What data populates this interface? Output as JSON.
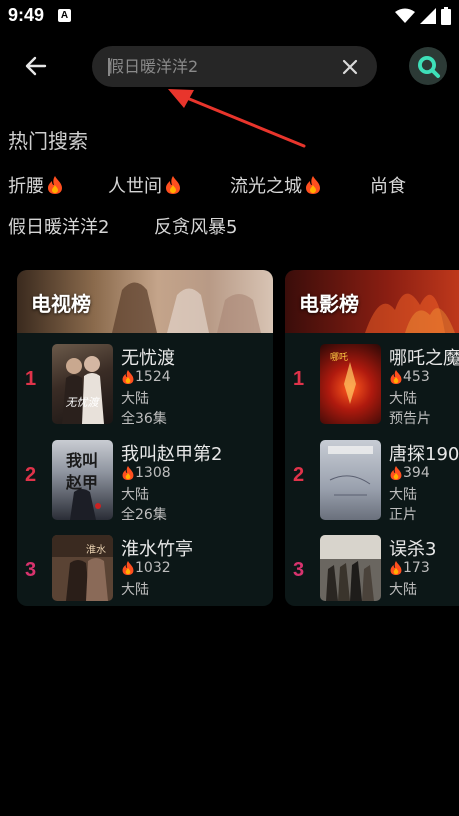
{
  "status": {
    "time": "9:49",
    "notif": "A"
  },
  "search": {
    "value": "",
    "placeholder": "假日暖洋洋2"
  },
  "hot_search": {
    "title": "热门搜索",
    "row1": [
      "折腰",
      "人世间",
      "流光之城",
      "尚食"
    ],
    "row1_hot": [
      true,
      true,
      true,
      false
    ],
    "row2": [
      "假日暖洋洋2",
      "反贪风暴5"
    ]
  },
  "tv_chart": {
    "title": "电视榜",
    "items": [
      {
        "rank": "1",
        "title": "无忧渡",
        "heat": "1524",
        "region": "大陆",
        "status": "全36集",
        "rank_color": "#e0334a"
      },
      {
        "rank": "2",
        "title": "我叫赵甲第2",
        "heat": "1308",
        "region": "大陆",
        "status": "全26集",
        "rank_color": "#e0334a"
      },
      {
        "rank": "3",
        "title": "淮水竹亭",
        "heat": "1032",
        "region": "大陆",
        "status": "",
        "rank_color": "#d8336e"
      }
    ]
  },
  "movie_chart": {
    "title": "电影榜",
    "items": [
      {
        "rank": "1",
        "title": "哪吒之魔",
        "heat": "453",
        "region": "大陆",
        "status": "预告片",
        "rank_color": "#e0334a"
      },
      {
        "rank": "2",
        "title": "唐探190",
        "heat": "394",
        "region": "大陆",
        "status": "正片",
        "rank_color": "#e0334a"
      },
      {
        "rank": "3",
        "title": "误杀3",
        "heat": "173",
        "region": "大陆",
        "status": "",
        "rank_color": "#d8336e"
      }
    ]
  },
  "colors": {
    "background": "#000000",
    "card": "#0c1717",
    "search_box": "#262626",
    "search_button": "#2c3a36",
    "accent_arrow": "#e8352c"
  }
}
